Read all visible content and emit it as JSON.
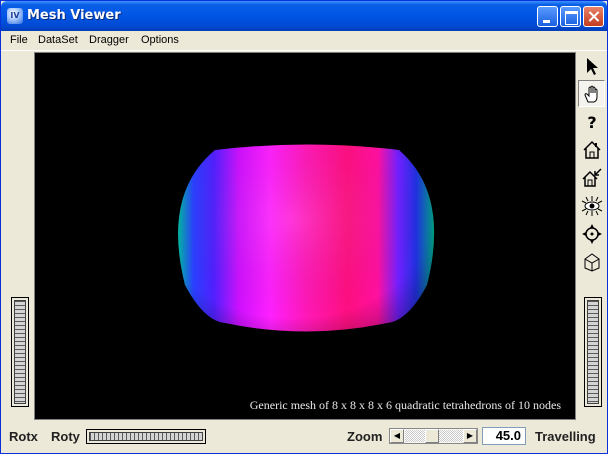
{
  "window": {
    "title": "Mesh Viewer",
    "app_icon": "IV",
    "controls": [
      "minimize-icon",
      "maximize-icon",
      "close-icon"
    ]
  },
  "menu": {
    "items": [
      "File",
      "DataSet",
      "Dragger",
      "Options"
    ]
  },
  "viewport": {
    "caption": "Generic mesh of 8 x 8 x 8 x 6 quadratic tetrahedrons of 10 nodes",
    "background": "#000000",
    "shape_colors": [
      "#ff00ff",
      "#ff0080",
      "#3020ff",
      "#00c0a0"
    ]
  },
  "toolbar": {
    "tools": [
      "select-arrow-icon",
      "hand-icon",
      "help-icon",
      "home-icon",
      "set-home-icon",
      "view-all-icon",
      "seek-icon",
      "projection-icon"
    ],
    "pressed": "hand-icon"
  },
  "bottom": {
    "rotx_label": "Rotx",
    "roty_label": "Roty",
    "zoom_label": "Zoom",
    "zoom_value": "45.0",
    "travelling_label": "Travelling"
  }
}
